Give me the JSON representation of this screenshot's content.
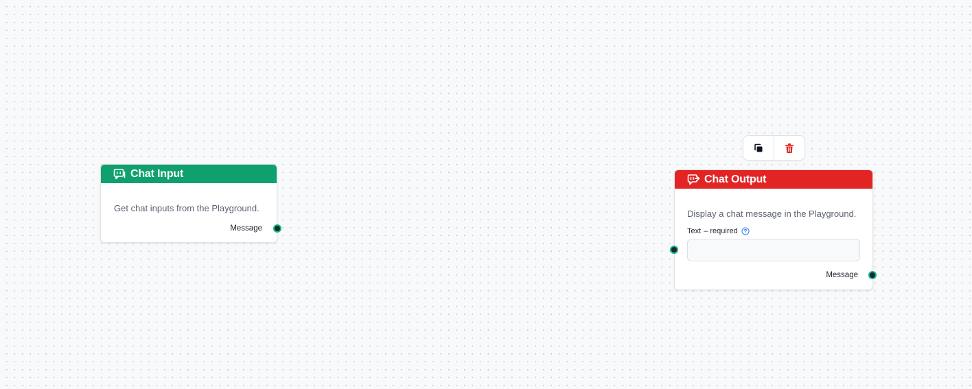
{
  "canvas": {
    "nodes": [
      {
        "title": "Chat Input",
        "icon": "chat-input-icon",
        "header_color": "#10a06d",
        "description": "Get chat inputs from the Playground.",
        "output_label": "Message"
      },
      {
        "title": "Chat Output",
        "icon": "chat-output-icon",
        "header_color": "#e32424",
        "description": "Display a chat message in the Playground.",
        "field": {
          "label": "Text",
          "required_text": "– required",
          "value": ""
        },
        "output_label": "Message"
      }
    ],
    "toolbar": {
      "buttons": [
        {
          "icon": "copy-icon"
        },
        {
          "icon": "trash-icon",
          "color": "#e32424"
        }
      ]
    },
    "handle_color": "#10b981"
  }
}
